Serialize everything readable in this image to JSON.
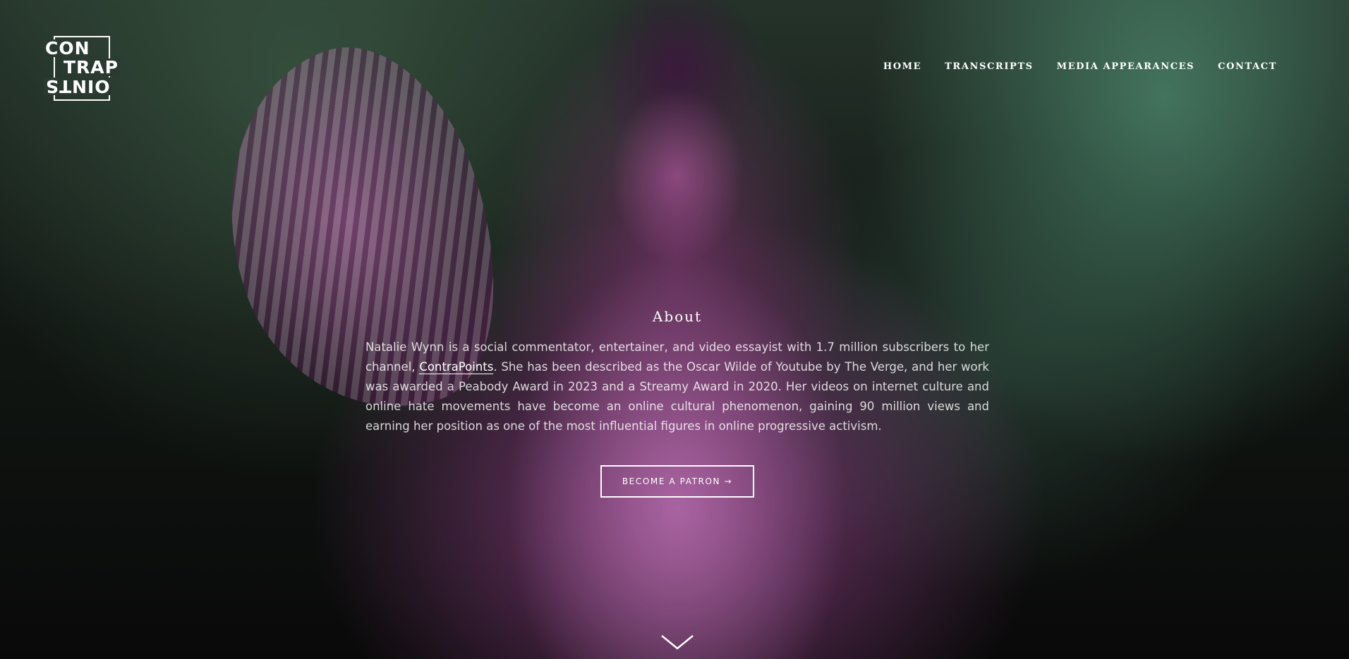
{
  "brand": {
    "logo_line_1": "CON",
    "logo_line_2": "TRAP",
    "logo_line_3": "OINTS"
  },
  "nav": {
    "items": [
      {
        "label": "HOME"
      },
      {
        "label": "TRANSCRIPTS"
      },
      {
        "label": "MEDIA APPEARANCES"
      },
      {
        "label": "CONTACT"
      }
    ]
  },
  "about": {
    "title": "About",
    "text_before_link": "Natalie Wynn is a social commentator, entertainer, and video essayist with 1.7 million subscribers to her channel, ",
    "link_label": "ContraPoints",
    "text_after_link": ". She has been described as the Oscar Wilde of Youtube by The Verge, and her work was awarded a Peabody Award in 2023 and a Streamy Award in 2020. Her videos on internet culture and online hate movements have become an online cultural phenomenon, gaining 90 million views and earning her position as one of the most influential figures in online progressive activism."
  },
  "cta": {
    "label": "BECOME A PATRON →"
  },
  "icons": {
    "scroll": "chevron-down-icon"
  },
  "colors": {
    "text": "#ffffff",
    "magenta": "#b84fa6",
    "green": "#6ec8a0"
  }
}
